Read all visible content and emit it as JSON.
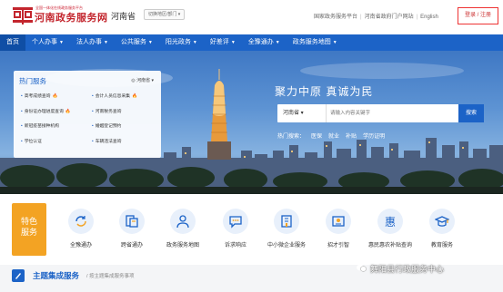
{
  "header": {
    "logo_sub": "全国一体化在线政务服务平台",
    "logo_title": "河南政务服务网",
    "province": "河南省",
    "switch_label": "切换地区/部门 ▾",
    "links": [
      "国家政务服务平台",
      "河南省政府门户网站",
      "English"
    ],
    "login_label": "登录 / 注册"
  },
  "nav": {
    "items": [
      {
        "label": "首页",
        "caret": false
      },
      {
        "label": "个人办事",
        "caret": true
      },
      {
        "label": "法人办事",
        "caret": true
      },
      {
        "label": "公共服务",
        "caret": true
      },
      {
        "label": "阳光政务",
        "caret": true
      },
      {
        "label": "好差评",
        "caret": true
      },
      {
        "label": "全豫通办",
        "caret": true
      },
      {
        "label": "政务服务地图",
        "caret": true
      }
    ]
  },
  "hot_services": {
    "title": "热门服务",
    "area_label": "◎ 河南省 ▾",
    "items": [
      {
        "label": "高考成绩查询",
        "hot": true
      },
      {
        "label": "会计人员信息采集",
        "hot": true
      },
      {
        "label": "身份证办理进度查询",
        "hot": true
      },
      {
        "label": "河南税务查询",
        "hot": false
      },
      {
        "label": "新冠疫苗接种机构",
        "hot": false
      },
      {
        "label": "婚姻登记预约",
        "hot": false
      },
      {
        "label": "学位认证",
        "hot": false
      },
      {
        "label": "车辆违法查询",
        "hot": false
      }
    ]
  },
  "search": {
    "slogan": "聚力中原  真诚为民",
    "scope": "河南省 ▾",
    "placeholder": "请输入内容关键字",
    "button": "搜索",
    "hot_label": "热门搜索：",
    "hot_terms": [
      "医保",
      "就业",
      "补贴",
      "学历证明"
    ]
  },
  "feature": {
    "label_line1": "特色",
    "label_line2": "服务"
  },
  "services": [
    {
      "label": "全豫通办",
      "icon": "refresh-icon"
    },
    {
      "label": "跨省通办",
      "icon": "document-exchange-icon"
    },
    {
      "label": "政务服务地图",
      "icon": "map-person-icon"
    },
    {
      "label": "诉求响应",
      "icon": "chat-icon"
    },
    {
      "label": "中小微企业服务",
      "icon": "building-icon"
    },
    {
      "label": "招才引智",
      "icon": "talent-icon"
    },
    {
      "label": "惠民惠农补贴查询",
      "icon": "hui-icon"
    },
    {
      "label": "教育服务",
      "icon": "graduation-cap-icon"
    }
  ],
  "bottom": {
    "title": "主题集成服务",
    "subtitle": "/ 按主题集成服务事项"
  },
  "watermark": "舞阳县行政服务中心",
  "colors": {
    "primary": "#1c63c7",
    "accent": "#f3a323",
    "brand_red": "#c3252d"
  }
}
